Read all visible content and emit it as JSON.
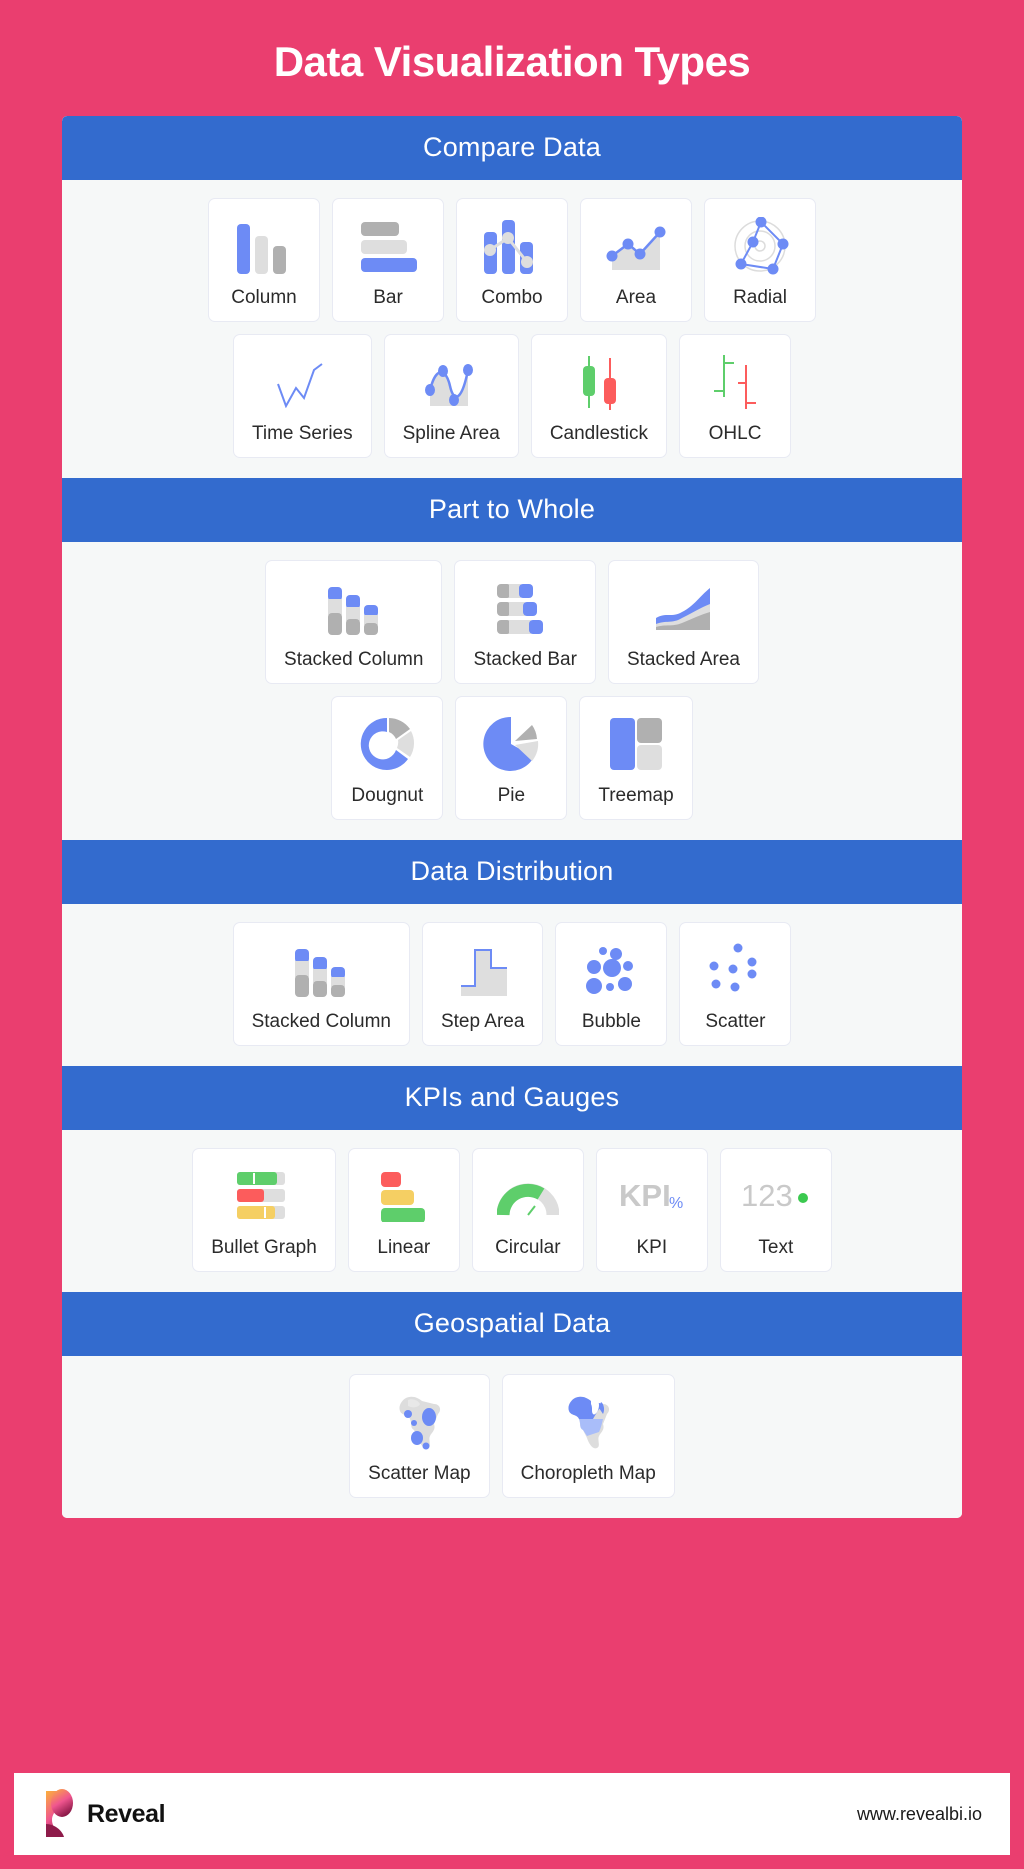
{
  "title": "Data Visualization Types",
  "colors": {
    "background": "#ea3e6f",
    "section_header": "#336bce",
    "board": "#f6f8f8",
    "card": "#ffffff",
    "accent_blue": "#6d8bf5",
    "grey_dark": "#b0b0b0",
    "grey_light": "#dedede",
    "green": "#5ece6b",
    "red": "#fc5c5c",
    "yellow": "#f5cf63",
    "text": "#2b2b2b"
  },
  "sections": [
    {
      "header": "Compare Data",
      "rows": [
        [
          {
            "label": "Column",
            "icon": "column-chart-icon"
          },
          {
            "label": "Bar",
            "icon": "bar-chart-icon"
          },
          {
            "label": "Combo",
            "icon": "combo-chart-icon"
          },
          {
            "label": "Area",
            "icon": "area-chart-icon"
          },
          {
            "label": "Radial",
            "icon": "radial-chart-icon"
          }
        ],
        [
          {
            "label": "Time Series",
            "icon": "time-series-chart-icon"
          },
          {
            "label": "Spline Area",
            "icon": "spline-area-chart-icon"
          },
          {
            "label": "Candlestick",
            "icon": "candlestick-chart-icon"
          },
          {
            "label": "OHLC",
            "icon": "ohlc-chart-icon"
          }
        ]
      ]
    },
    {
      "header": "Part to Whole",
      "rows": [
        [
          {
            "label": "Stacked Column",
            "icon": "stacked-column-chart-icon"
          },
          {
            "label": "Stacked Bar",
            "icon": "stacked-bar-chart-icon"
          },
          {
            "label": "Stacked Area",
            "icon": "stacked-area-chart-icon"
          }
        ],
        [
          {
            "label": "Dougnut",
            "icon": "doughnut-chart-icon"
          },
          {
            "label": "Pie",
            "icon": "pie-chart-icon"
          },
          {
            "label": "Treemap",
            "icon": "treemap-chart-icon"
          }
        ]
      ]
    },
    {
      "header": "Data Distribution",
      "rows": [
        [
          {
            "label": "Stacked Column",
            "icon": "stacked-column-chart-icon"
          },
          {
            "label": "Step Area",
            "icon": "step-area-chart-icon"
          },
          {
            "label": "Bubble",
            "icon": "bubble-chart-icon"
          },
          {
            "label": "Scatter",
            "icon": "scatter-chart-icon"
          }
        ]
      ]
    },
    {
      "header": "KPIs and Gauges",
      "rows": [
        [
          {
            "label": "Bullet Graph",
            "icon": "bullet-graph-icon"
          },
          {
            "label": "Linear",
            "icon": "linear-gauge-icon"
          },
          {
            "label": "Circular",
            "icon": "circular-gauge-icon"
          },
          {
            "label": "KPI",
            "icon": "kpi-icon",
            "glyph_text": "KPI",
            "glyph_sub": "%"
          },
          {
            "label": "Text",
            "icon": "text-kpi-icon",
            "glyph_text": "123"
          }
        ]
      ]
    },
    {
      "header": "Geospatial Data",
      "rows": [
        [
          {
            "label": "Scatter Map",
            "icon": "scatter-map-icon"
          },
          {
            "label": "Choropleth Map",
            "icon": "choropleth-map-icon"
          }
        ]
      ]
    }
  ],
  "footer": {
    "brand": "Reveal",
    "website": "www.revealbi.io"
  }
}
